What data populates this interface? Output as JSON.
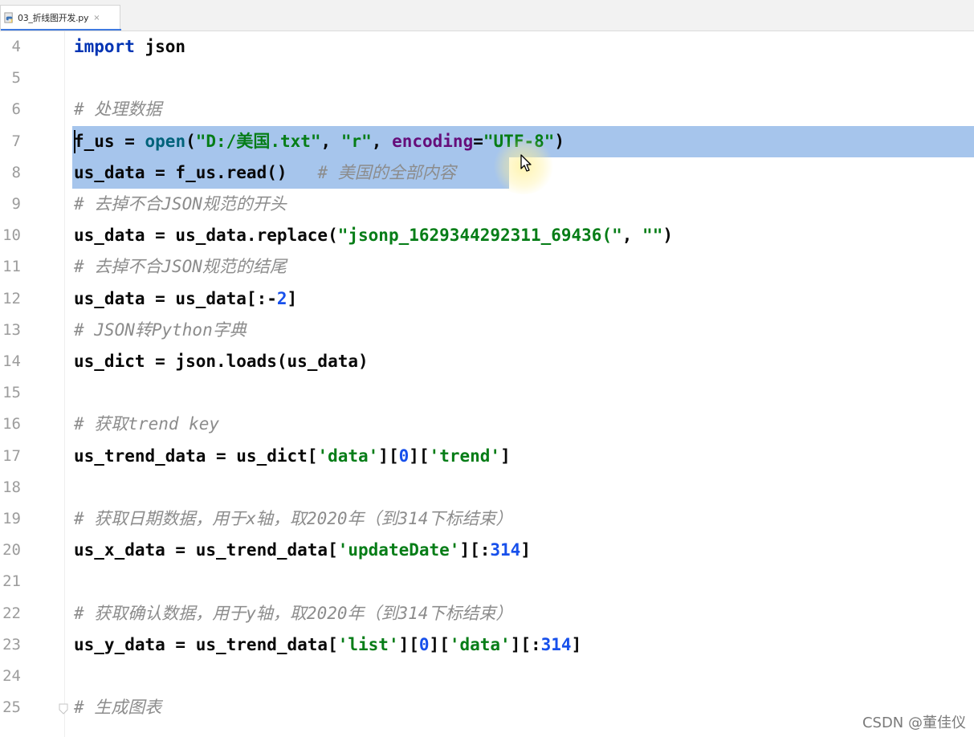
{
  "tab": {
    "filename": "03_折线图开发.py",
    "close_glyph": "×",
    "icon": "python-file-icon"
  },
  "lines": [
    {
      "no": "4",
      "code": "import json"
    },
    {
      "no": "5",
      "code": ""
    },
    {
      "no": "6",
      "code": "# 处理数据"
    },
    {
      "no": "7",
      "code": "f_us = open(\"D:/美国.txt\", \"r\", encoding=\"UTF-8\")"
    },
    {
      "no": "8",
      "code": "us_data = f_us.read()   # 美国的全部内容"
    },
    {
      "no": "9",
      "code": "# 去掉不合JSON规范的开头"
    },
    {
      "no": "10",
      "code": "us_data = us_data.replace(\"jsonp_1629344292311_69436(\", \"\")"
    },
    {
      "no": "11",
      "code": "# 去掉不合JSON规范的结尾"
    },
    {
      "no": "12",
      "code": "us_data = us_data[:-2]"
    },
    {
      "no": "13",
      "code": "# JSON转Python字典"
    },
    {
      "no": "14",
      "code": "us_dict = json.loads(us_data)"
    },
    {
      "no": "15",
      "code": ""
    },
    {
      "no": "16",
      "code": "# 获取trend key"
    },
    {
      "no": "17",
      "code": "us_trend_data = us_dict['data'][0]['trend']"
    },
    {
      "no": "18",
      "code": ""
    },
    {
      "no": "19",
      "code": "# 获取日期数据，用于x轴，取2020年（到314下标结束）"
    },
    {
      "no": "20",
      "code": "us_x_data = us_trend_data['updateDate'][:314]"
    },
    {
      "no": "21",
      "code": ""
    },
    {
      "no": "22",
      "code": "# 获取确认数据，用于y轴，取2020年（到314下标结束）"
    },
    {
      "no": "23",
      "code": "us_y_data = us_trend_data['list'][0]['data'][:314]"
    },
    {
      "no": "24",
      "code": ""
    },
    {
      "no": "25",
      "code": "# 生成图表"
    }
  ],
  "watermark": "CSDN @董佳仪",
  "colors": {
    "keyword": "#0033b3",
    "function": "#00627a",
    "string": "#067d17",
    "number": "#1750eb",
    "parameter": "#660e7a",
    "comment": "#8c8c8c",
    "selection": "#a6c5ec"
  }
}
